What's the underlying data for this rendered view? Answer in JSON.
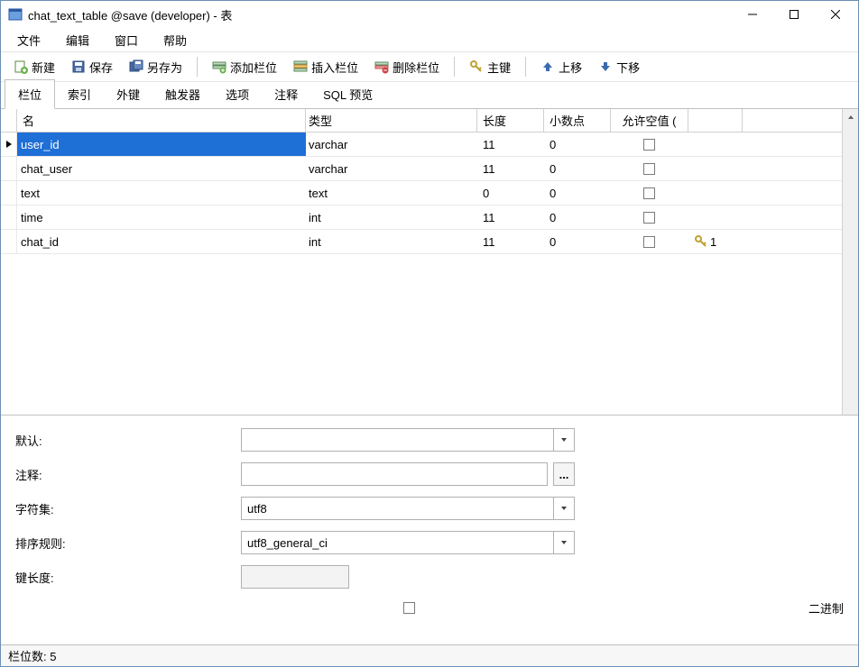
{
  "window": {
    "title": "chat_text_table @save (developer) - 表"
  },
  "menu": {
    "file": "文件",
    "edit": "编辑",
    "window": "窗口",
    "help": "帮助"
  },
  "toolbar": {
    "new": "新建",
    "save": "保存",
    "save_as": "另存为",
    "add_field": "添加栏位",
    "insert_field": "插入栏位",
    "delete_field": "删除栏位",
    "primary_key": "主键",
    "move_up": "上移",
    "move_down": "下移"
  },
  "tabs": {
    "fields": "栏位",
    "indexes": "索引",
    "foreign_keys": "外键",
    "triggers": "触发器",
    "options": "选项",
    "comment": "注释",
    "sql_preview": "SQL 预览"
  },
  "columns": {
    "name": "名",
    "type": "类型",
    "length": "长度",
    "decimals": "小数点",
    "allow_null": "允许空值 ("
  },
  "rows": [
    {
      "name": "user_id",
      "type": "varchar",
      "length": "11",
      "decimals": "0",
      "allow_null": false,
      "key": ""
    },
    {
      "name": "chat_user",
      "type": "varchar",
      "length": "11",
      "decimals": "0",
      "allow_null": false,
      "key": ""
    },
    {
      "name": "text",
      "type": "text",
      "length": "0",
      "decimals": "0",
      "allow_null": false,
      "key": ""
    },
    {
      "name": "time",
      "type": "int",
      "length": "11",
      "decimals": "0",
      "allow_null": false,
      "key": ""
    },
    {
      "name": "chat_id",
      "type": "int",
      "length": "11",
      "decimals": "0",
      "allow_null": false,
      "key": "1"
    }
  ],
  "props": {
    "default_label": "默认:",
    "default_value": "",
    "comment_label": "注释:",
    "comment_value": "",
    "charset_label": "字符集:",
    "charset_value": "utf8",
    "collation_label": "排序规则:",
    "collation_value": "utf8_general_ci",
    "keylen_label": "键长度:",
    "keylen_value": "",
    "binary_label": "二进制",
    "ellipsis": "..."
  },
  "status": {
    "field_count_label": "栏位数: 5"
  }
}
